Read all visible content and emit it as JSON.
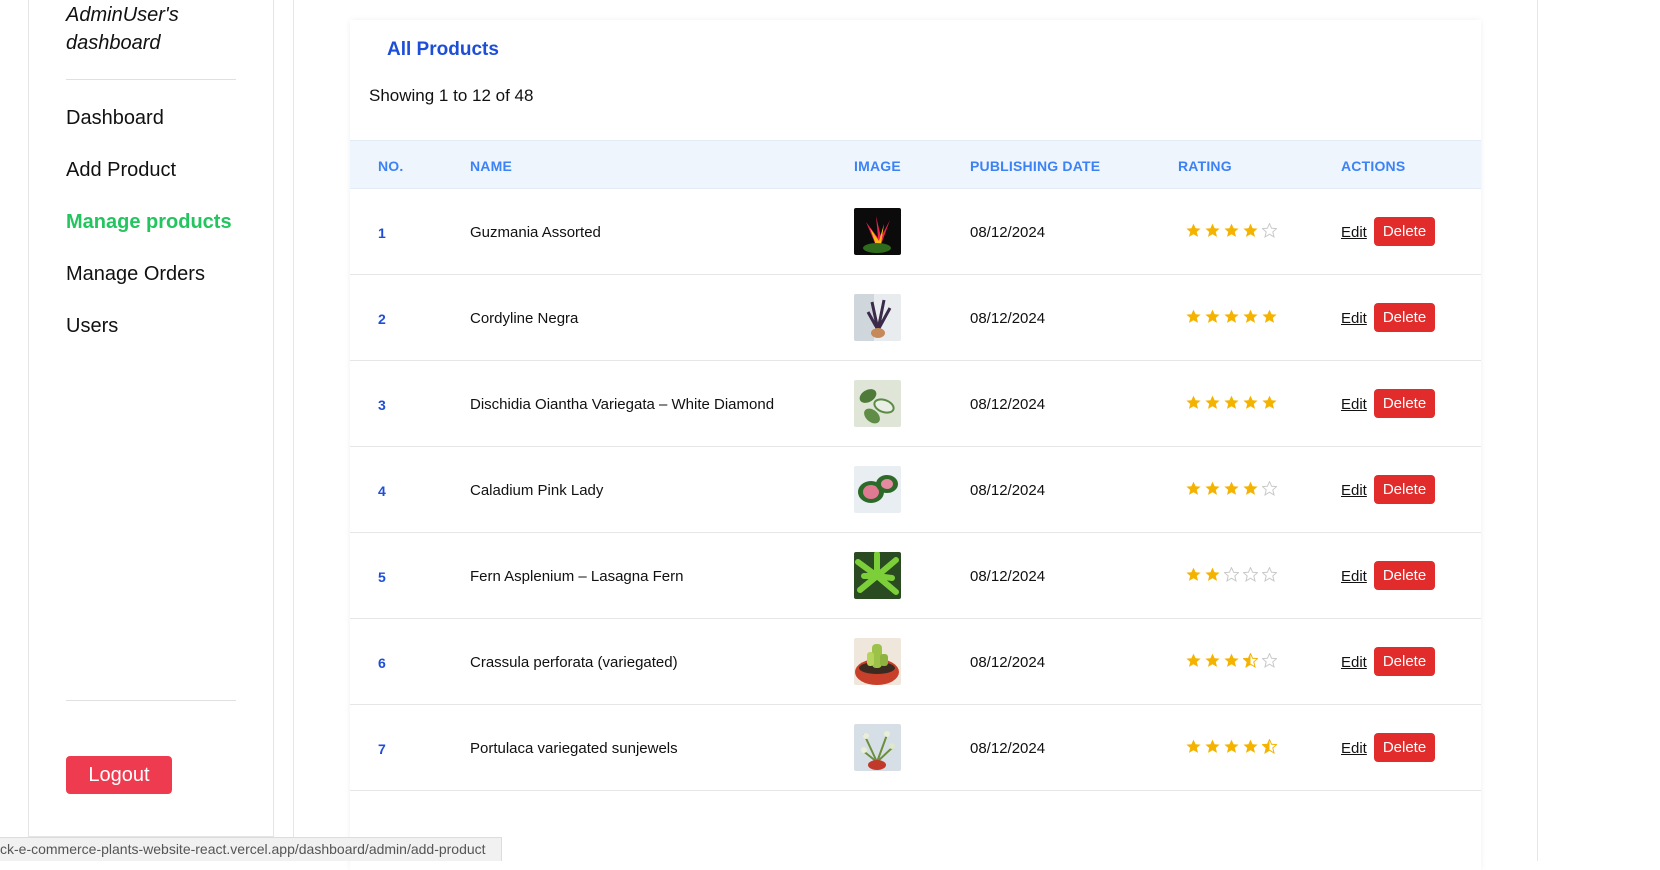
{
  "sidebar": {
    "brand": "AdminUser's dashboard",
    "items": [
      {
        "label": "Dashboard",
        "active": false
      },
      {
        "label": "Add Product",
        "active": false
      },
      {
        "label": "Manage products",
        "active": true
      },
      {
        "label": "Manage Orders",
        "active": false
      },
      {
        "label": "Users",
        "active": false
      }
    ],
    "logout_label": "Logout"
  },
  "main": {
    "title": "All Products",
    "showing": "Showing 1 to 12 of 48",
    "columns": [
      "NO.",
      "NAME",
      "IMAGE",
      "PUBLISHING DATE",
      "RATING",
      "ACTIONS"
    ],
    "edit_label": "Edit",
    "delete_label": "Delete",
    "rows": [
      {
        "no": "1",
        "name": "Guzmania Assorted",
        "date": "08/12/2024",
        "rating": 4,
        "image": "plant-photo-1"
      },
      {
        "no": "2",
        "name": "Cordyline Negra",
        "date": "08/12/2024",
        "rating": 5,
        "image": "plant-photo-2"
      },
      {
        "no": "3",
        "name": "Dischidia Oiantha Variegata – White Diamond",
        "date": "08/12/2024",
        "rating": 5,
        "image": "plant-photo-3"
      },
      {
        "no": "4",
        "name": "Caladium Pink Lady",
        "date": "08/12/2024",
        "rating": 4,
        "image": "plant-photo-4"
      },
      {
        "no": "5",
        "name": "Fern Asplenium – Lasagna Fern",
        "date": "08/12/2024",
        "rating": 2,
        "image": "plant-photo-5"
      },
      {
        "no": "6",
        "name": "Crassula perforata (variegated)",
        "date": "08/12/2024",
        "rating": 3.5,
        "image": "plant-photo-6"
      },
      {
        "no": "7",
        "name": "Portulaca variegated sunjewels",
        "date": "08/12/2024",
        "rating": 4.5,
        "image": "plant-photo-7"
      }
    ]
  },
  "status_bar": {
    "url": "ck-e-commerce-plants-website-react.vercel.app/dashboard/admin/add-product"
  },
  "colors": {
    "accent_blue": "#1d4ed8",
    "header_blue": "#3b82f6",
    "active_green": "#22c55e",
    "delete_red": "#e22b2b",
    "logout_red": "#ef3b4f",
    "star_gold": "#f5b301"
  }
}
